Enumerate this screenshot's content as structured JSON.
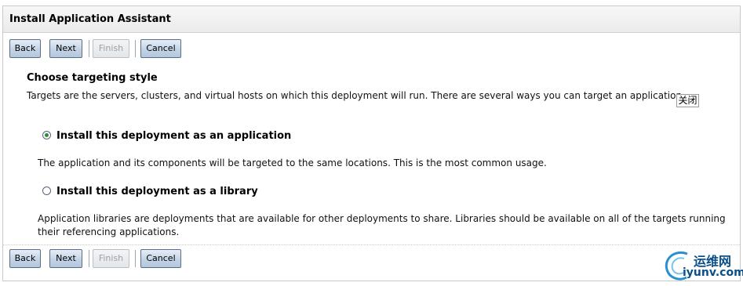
{
  "window": {
    "title": "Install Application Assistant"
  },
  "toolbar": {
    "back": "Back",
    "next": "Next",
    "finish": "Finish",
    "cancel": "Cancel"
  },
  "content": {
    "section_title": "Choose targeting style",
    "description": "Targets are the servers, clusters, and virtual hosts on which this deployment will run. There are several ways you can target an application.",
    "close_label": "关闭",
    "options": [
      {
        "label": "Install this deployment as an application",
        "checked": true,
        "description": "The application and its components will be targeted to the same locations. This is the most common usage."
      },
      {
        "label": "Install this deployment as a library",
        "checked": false,
        "description": "Application libraries are deployments that are available for other deployments to share. Libraries should be available on all of the targets running their referencing applications."
      }
    ]
  },
  "watermark": {
    "cn": "运维网",
    "en": "iyunv.com"
  },
  "colors": {
    "selected_radio": "#2e8a3a",
    "button_border": "#5a6d84"
  }
}
